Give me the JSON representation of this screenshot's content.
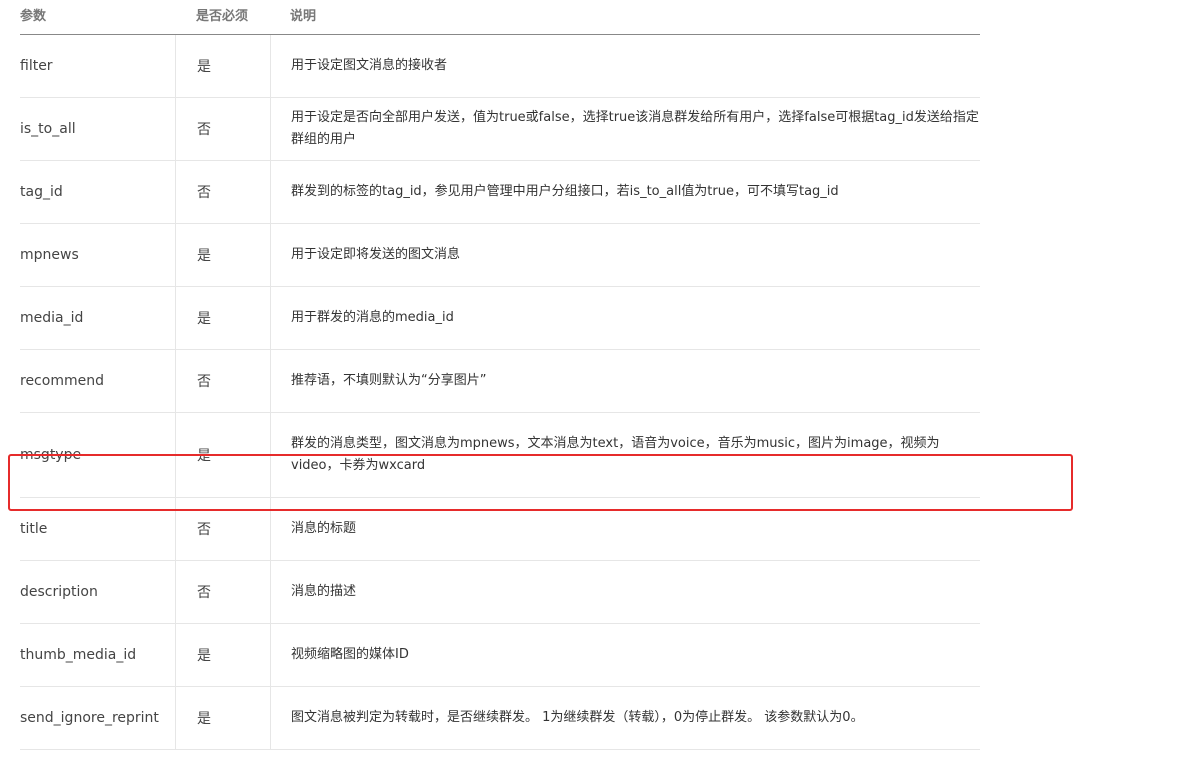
{
  "table": {
    "headers": {
      "param": "参数",
      "required": "是否必须",
      "description": "说明"
    },
    "rows": [
      {
        "param": "filter",
        "required": "是",
        "description": "用于设定图文消息的接收者"
      },
      {
        "param": "is_to_all",
        "required": "否",
        "description": "用于设定是否向全部用户发送，值为true或false，选择true该消息群发给所有用户，选择false可根据tag_id发送给指定群组的用户"
      },
      {
        "param": "tag_id",
        "required": "否",
        "description": "群发到的标签的tag_id，参见用户管理中用户分组接口，若is_to_all值为true，可不填写tag_id"
      },
      {
        "param": "mpnews",
        "required": "是",
        "description": "用于设定即将发送的图文消息"
      },
      {
        "param": "media_id",
        "required": "是",
        "description": "用于群发的消息的media_id"
      },
      {
        "param": "recommend",
        "required": "否",
        "description": "推荐语，不填则默认为“分享图片”"
      },
      {
        "param": "msgtype",
        "required": "是",
        "description": "群发的消息类型，图文消息为mpnews，文本消息为text，语音为voice，音乐为music，图片为image，视频为video，卡券为wxcard"
      },
      {
        "param": "title",
        "required": "否",
        "description": "消息的标题"
      },
      {
        "param": "description",
        "required": "否",
        "description": "消息的描述"
      },
      {
        "param": "thumb_media_id",
        "required": "是",
        "description": "视频缩略图的媒体ID"
      },
      {
        "param": "send_ignore_reprint",
        "required": "是",
        "description": "图文消息被判定为转载时，是否继续群发。 1为继续群发（转载），0为停止群发。 该参数默认为0。"
      }
    ]
  },
  "colors": {
    "highlight": "#e62b2b"
  }
}
